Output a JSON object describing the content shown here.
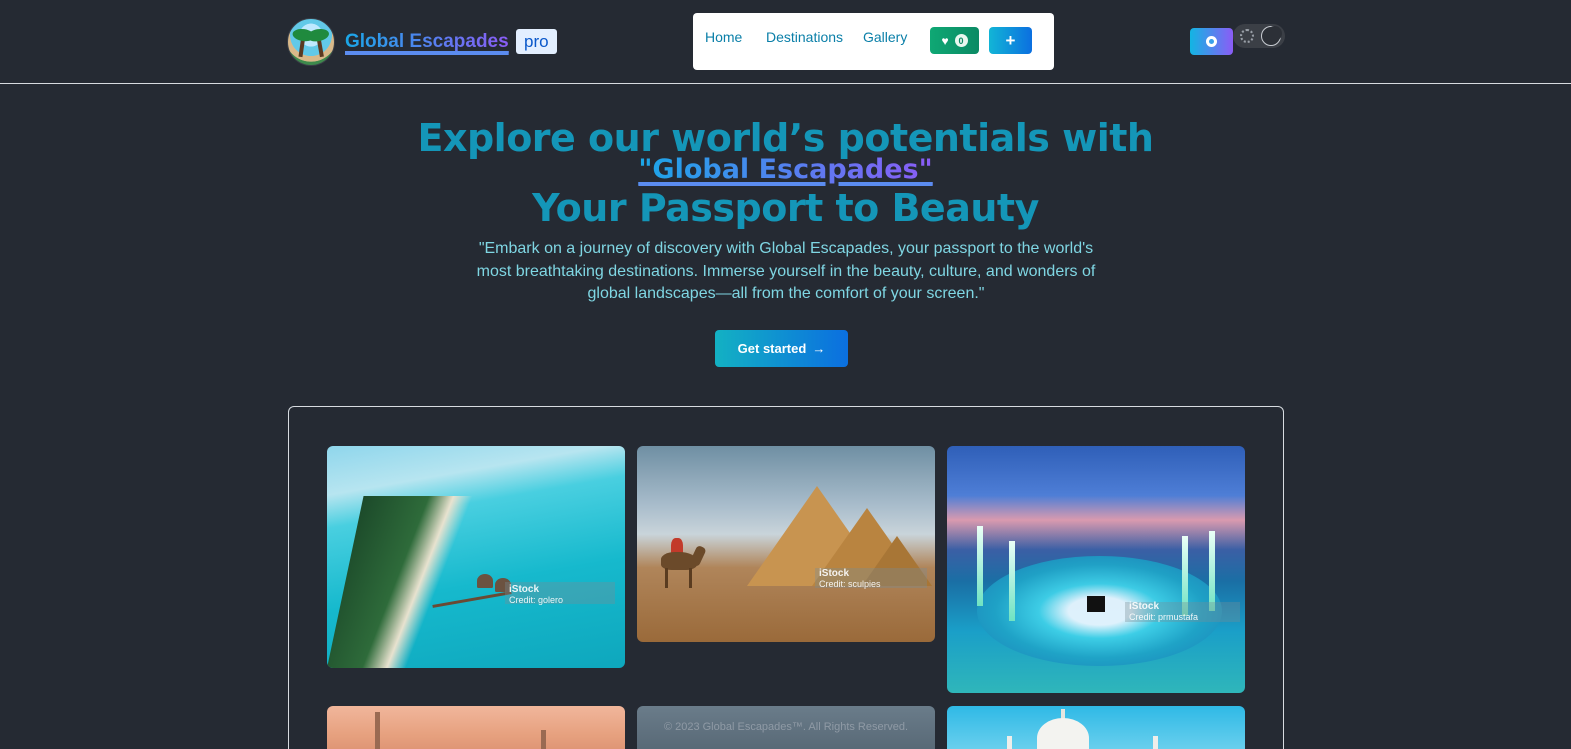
{
  "header": {
    "brand": "Global Escapades",
    "badge": "pro",
    "nav": {
      "home": "Home",
      "destinations": "Destinations",
      "gallery": "Gallery",
      "favorites_count": "0",
      "add_label": "+"
    }
  },
  "hero": {
    "line1": "Explore our world’s potentials with",
    "brand_quote": "\"Global Escapades\"",
    "line3": "Your Passport to Beauty",
    "description": "\"Embark on a journey of discovery with Global Escapades, your passport to the world's most breathtaking destinations. Immerse yourself in the beauty, culture, and wonders of global landscapes—all from the comfort of your screen.\"",
    "cta_label": "Get started",
    "cta_arrow": "→"
  },
  "gallery": {
    "photos": [
      {
        "watermark": "iStock",
        "credit": "Credit: golero"
      },
      {
        "watermark": "iStock",
        "credit": "Credit: sculpies"
      },
      {
        "watermark": "iStock",
        "credit": "Credit: prmustafa"
      }
    ],
    "overlay_text": "© 2023 Global Escapades™. All Rights Reserved."
  },
  "colors": {
    "background": "#252a33",
    "accent": "#1496b8",
    "brand_gradient_start": "#1aa7e8",
    "brand_gradient_end": "#8b5cf6"
  },
  "icons": [
    "logo-image",
    "heart-icon",
    "plus-icon",
    "github-icon",
    "sun-icon",
    "moon-icon",
    "arrow-right-icon"
  ]
}
